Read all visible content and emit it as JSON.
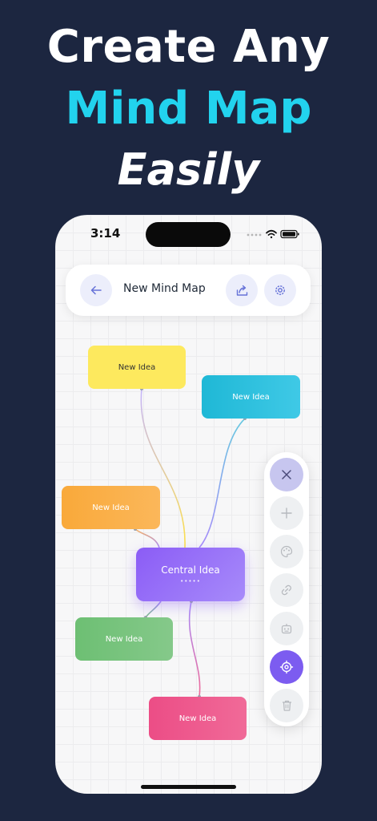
{
  "headline": {
    "line1": "Create Any",
    "line2": "Mind Map",
    "line3": "Easily",
    "accent_color": "#22d3ee",
    "background_color": "#1c2640"
  },
  "status_bar": {
    "time": "3:14"
  },
  "toolbar": {
    "title": "New Mind Map",
    "back_icon": "arrow-left-icon",
    "share_icon": "share-icon",
    "settings_icon": "gear-icon"
  },
  "mind_map": {
    "central": {
      "label": "Central Idea",
      "dots": "•••••",
      "color": "#8b5cf6"
    },
    "nodes": [
      {
        "label": "New Idea",
        "color": "#fde95e"
      },
      {
        "label": "New Idea",
        "color": "#22bcd9"
      },
      {
        "label": "New Idea",
        "color": "#f9a93a"
      },
      {
        "label": "New Idea",
        "color": "#6dbf73"
      },
      {
        "label": "New Idea",
        "color": "#ec4d86"
      }
    ]
  },
  "side_panel": {
    "icons": [
      "close-icon",
      "plus-icon",
      "palette-icon",
      "link-icon",
      "robot-icon",
      "target-icon",
      "trash-icon"
    ],
    "active_color": "#7c5cf0"
  }
}
